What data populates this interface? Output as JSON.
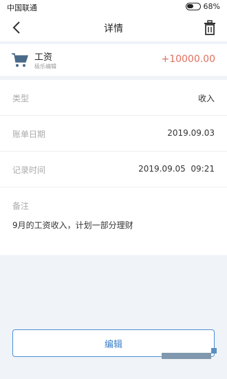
{
  "status_bar": {
    "carrier": "中国联通",
    "battery": "68%"
  },
  "nav": {
    "title": "详情"
  },
  "item": {
    "name": "工资",
    "subtitle": "极乐编辑",
    "amount": "+10000.00"
  },
  "details": [
    {
      "label": "类型",
      "value": "收入"
    },
    {
      "label": "账单日期",
      "value": "2019.09.03"
    },
    {
      "label": "记录时间",
      "value": "2019.09.05  09:21"
    }
  ],
  "note": {
    "label": "备注",
    "text": "9月的工资收入，计划一部分理财"
  },
  "actions": {
    "edit_label": "编辑"
  },
  "colors": {
    "amount": "#e07060",
    "accent": "#4a90d9"
  }
}
